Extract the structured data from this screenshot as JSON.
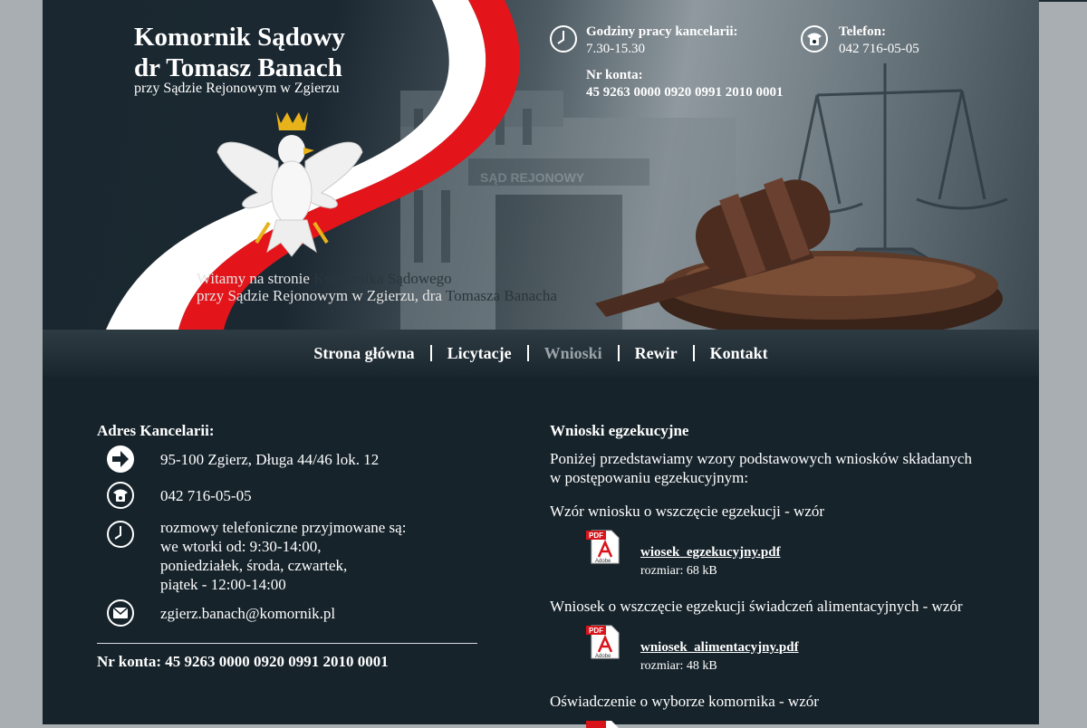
{
  "header": {
    "title_line1": "Komornik Sądowy",
    "title_line2": "dr Tomasz Banach",
    "subtitle": "przy Sądzie Rejonowym w Zgierzu",
    "welcome_a": "Witamy na stronie ",
    "welcome_b": "Komornika Sądowego",
    "welcome_c": "przy Sądzie Rejonowym w Zgierzu, dra ",
    "welcome_d": "Tomasza Banacha",
    "building_sign": "SĄD REJONOWY",
    "hours_label": "Godziny pracy kancelarii:",
    "hours_value": "7.30-15.30",
    "phone_label": "Telefon:",
    "phone_value": "042 716-05-05",
    "account_label": "Nr konta:",
    "account_value": "45 9263 0000 0920 0991 2010 0001"
  },
  "nav": {
    "items": [
      {
        "label": "Strona główna"
      },
      {
        "label": "Licytacje"
      },
      {
        "label": "Wnioski"
      },
      {
        "label": "Rewir"
      },
      {
        "label": "Kontakt"
      }
    ]
  },
  "office": {
    "heading": "Adres Kancelarii:",
    "address": "95-100 Zgierz, Długa 44/46 lok. 12",
    "phone": "042 716-05-05",
    "calls_line1": "rozmowy telefoniczne przyjmowane są:",
    "calls_line2": "we wtorki od: 9:30-14:00,",
    "calls_line3": "poniedziałek, środa, czwartek,",
    "calls_line4": "piątek - 12:00-14:00",
    "email": "zgierz.banach@komornik.pl",
    "account": "Nr konta: 45 9263 0000 0920 0991 2010 0001"
  },
  "content": {
    "heading": "Wnioski egzekucyjne",
    "intro_line1": "Poniżej przedstawiamy wzory podstawowych wniosków składanych",
    "intro_line2": "w postępowaniu egzekucyjnym:",
    "docs": [
      {
        "title": "Wzór wniosku o wszczęcie egzekucji - wzór",
        "file": "wiosek_egzekucyjny.pdf",
        "size": "rozmiar: 68 kB"
      },
      {
        "title": "Wniosek o wszczęcie egzekucji świadczeń alimentacyjnych - wzór",
        "file": "wniosek_alimentacyjny.pdf",
        "size": "rozmiar: 48 kB"
      },
      {
        "title": "Oświadczenie o wyborze komornika - wzór"
      }
    ],
    "pdf_badge": "PDF",
    "pdf_brand": "Adobe"
  },
  "colors": {
    "background": "#a8aeb1",
    "page": "#16232b",
    "flag_red": "#e3151a",
    "flag_white": "#ffffff",
    "nav_active": "#9aa3a8"
  },
  "icons": [
    "clock-icon",
    "phone-icon",
    "arrow-right-icon",
    "envelope-icon",
    "pdf-icon",
    "eagle-emblem",
    "gavel-image",
    "scales-image"
  ]
}
